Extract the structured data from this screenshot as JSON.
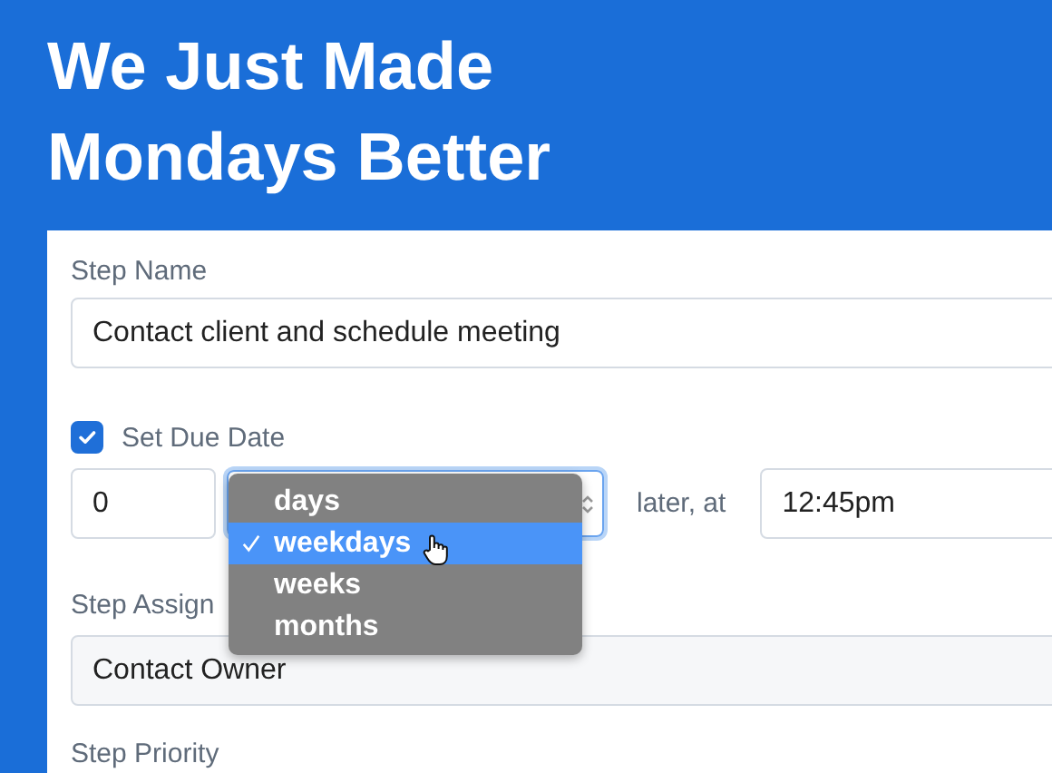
{
  "headline": [
    "We Just Made",
    "Mondays Better"
  ],
  "step_name": {
    "label": "Step Name",
    "value": "Contact client and schedule meeting"
  },
  "due_date": {
    "label": "Set Due Date",
    "checked": true,
    "amount": "0",
    "separator": "later, at",
    "time": "12:45pm"
  },
  "unit_menu": [
    {
      "label": "days",
      "selected": false
    },
    {
      "label": "weekdays",
      "selected": true
    },
    {
      "label": "weeks",
      "selected": false
    },
    {
      "label": "months",
      "selected": false
    }
  ],
  "step_assign": {
    "label": "Step Assign",
    "value": "Contact Owner"
  },
  "step_priority": {
    "label": "Step Priority"
  }
}
